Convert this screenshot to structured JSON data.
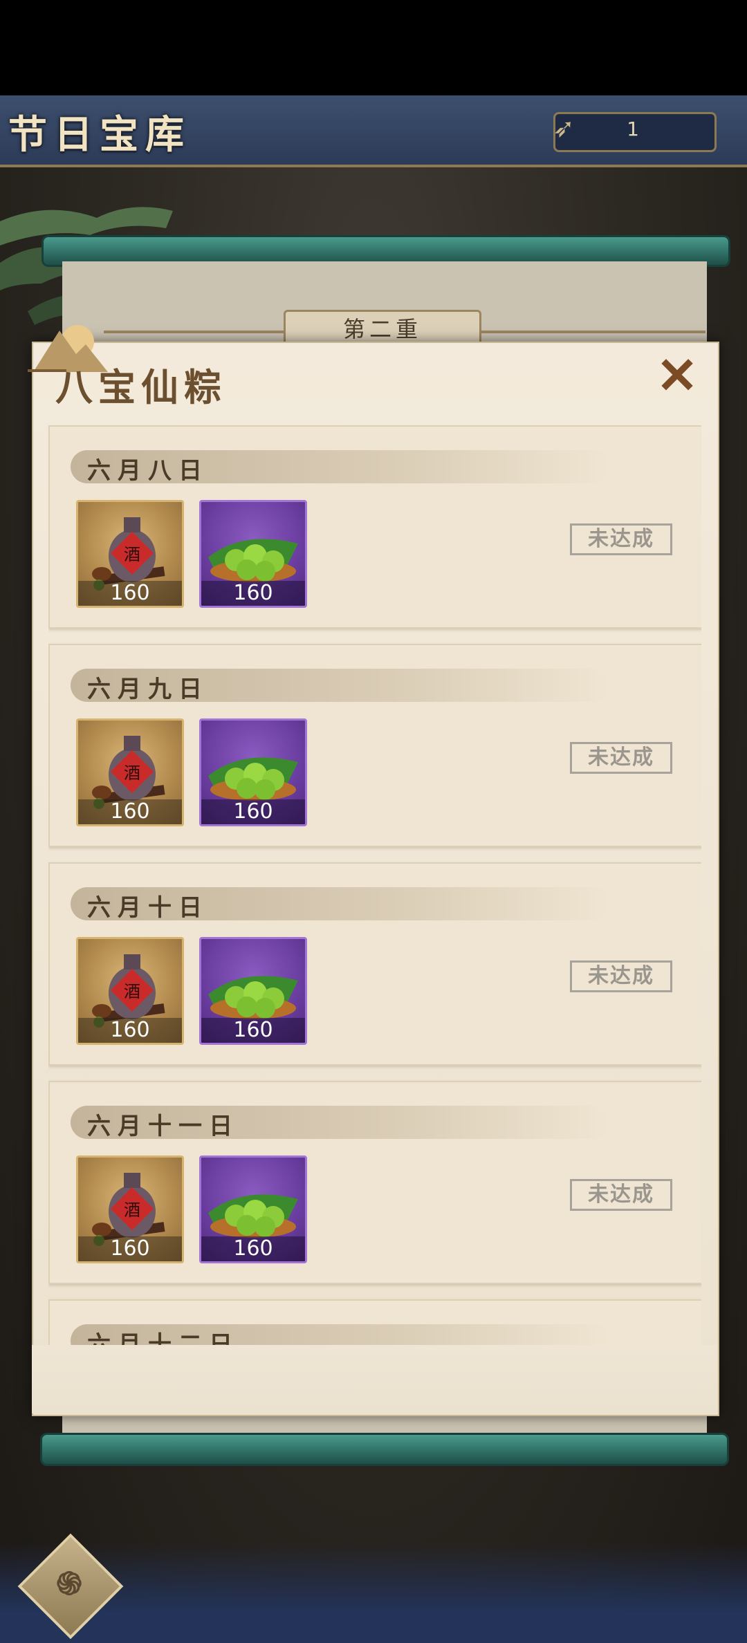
{
  "header": {
    "title": "节日宝库",
    "counter_value": "1"
  },
  "scroll": {
    "tier_label": "第二重"
  },
  "popup": {
    "title": "八宝仙粽",
    "close_glyph": "✕"
  },
  "items": {
    "wine_label": "酒"
  },
  "cards": [
    {
      "date": "六月八日",
      "reward1_qty": "160",
      "reward2_qty": "160",
      "status": "未达成"
    },
    {
      "date": "六月九日",
      "reward1_qty": "160",
      "reward2_qty": "160",
      "status": "未达成"
    },
    {
      "date": "六月十日",
      "reward1_qty": "160",
      "reward2_qty": "160",
      "status": "未达成"
    },
    {
      "date": "六月十一日",
      "reward1_qty": "160",
      "reward2_qty": "160",
      "status": "未达成"
    },
    {
      "date": "六月十二日",
      "reward1_qty": "",
      "reward2_qty": "",
      "status": ""
    }
  ],
  "colors": {
    "banner": "#2c3b57",
    "paper": "#f3eadb",
    "rod": "#2e6d63",
    "gold_frame": "#d6b36f",
    "purple_frame": "#a274d6"
  }
}
